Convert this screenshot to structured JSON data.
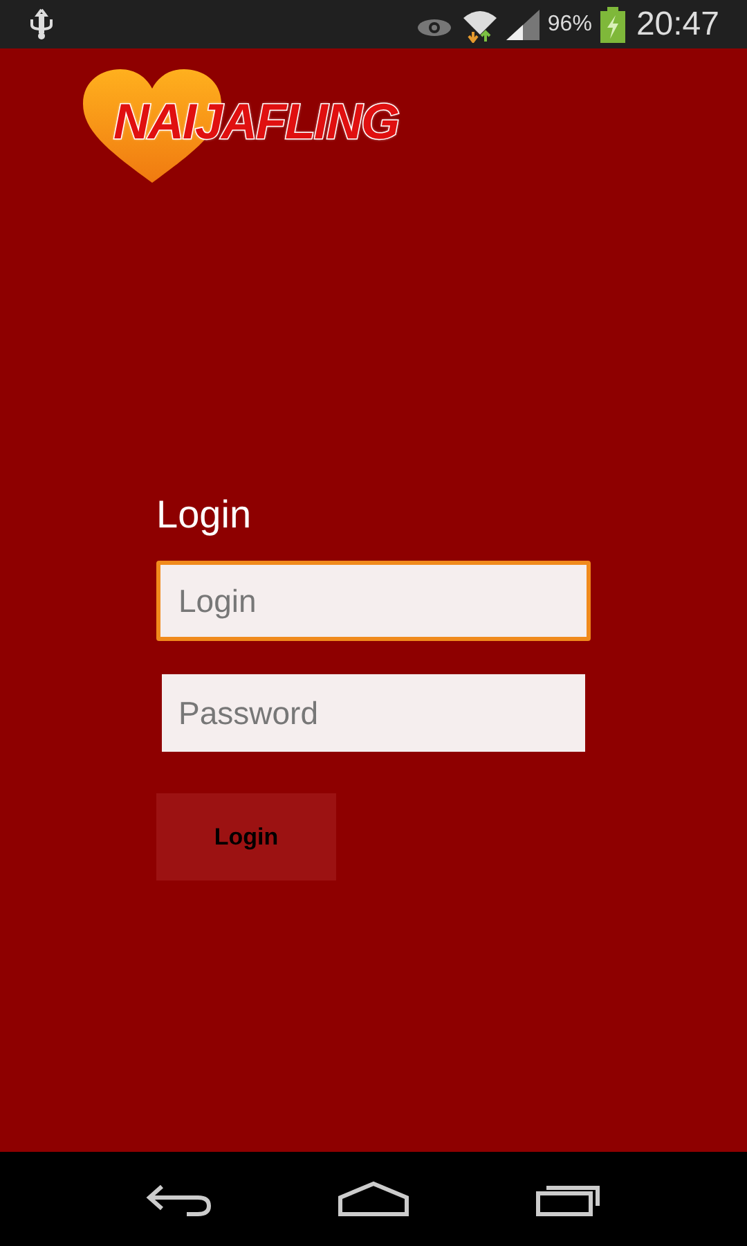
{
  "status_bar": {
    "battery": "96%",
    "time": "20:47"
  },
  "logo": {
    "text": "NAIJAFLING"
  },
  "form": {
    "title": "Login",
    "fields": [
      {
        "placeholder": "Login",
        "focused": true
      },
      {
        "placeholder": "Password",
        "focused": false
      }
    ],
    "button": "Login"
  }
}
